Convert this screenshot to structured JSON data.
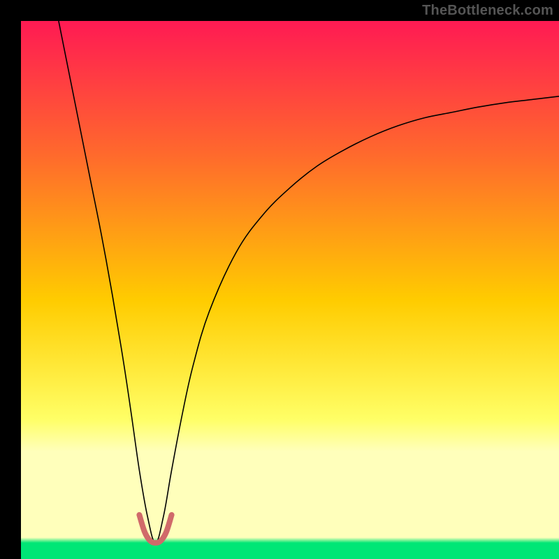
{
  "watermark": "TheBottleneck.com",
  "chart_data": {
    "type": "line",
    "title": "",
    "xlabel": "",
    "ylabel": "",
    "xlim": [
      0,
      100
    ],
    "ylim": [
      0,
      100
    ],
    "background_gradient": {
      "top_color": "#ff1a53",
      "mid_high_color": "#ff6a2c",
      "mid_color": "#ffcc00",
      "mid_low_color": "#ffff66",
      "low_band_color": "#ffffbb",
      "bottom_color": "#00e676"
    },
    "series": [
      {
        "name": "bottleneck_curve",
        "color": "#000000",
        "stroke_width": 1.6,
        "x": [
          7.0,
          9.0,
          11.0,
          13.0,
          15.0,
          17.0,
          19.0,
          20.5,
          22.0,
          23.5,
          25.0,
          26.5,
          28.0,
          30.0,
          32.0,
          35.0,
          40.0,
          45.0,
          50.0,
          55.0,
          60.0,
          65.0,
          70.0,
          75.0,
          80.0,
          85.0,
          90.0,
          95.0,
          100.0
        ],
        "values": [
          100.0,
          90.0,
          80.0,
          70.0,
          60.0,
          49.0,
          37.0,
          27.0,
          16.5,
          8.0,
          3.0,
          8.0,
          16.5,
          27.0,
          36.0,
          46.0,
          57.0,
          64.0,
          69.0,
          73.0,
          76.0,
          78.5,
          80.5,
          82.0,
          83.0,
          84.0,
          84.8,
          85.4,
          86.0
        ]
      },
      {
        "name": "valley_highlight",
        "color": "#d06a6a",
        "stroke_width": 8,
        "linecap": "round",
        "x": [
          22.0,
          23.0,
          24.0,
          25.0,
          26.0,
          27.0,
          28.0
        ],
        "values": [
          8.2,
          5.0,
          3.4,
          3.0,
          3.4,
          5.0,
          8.2
        ]
      }
    ]
  }
}
